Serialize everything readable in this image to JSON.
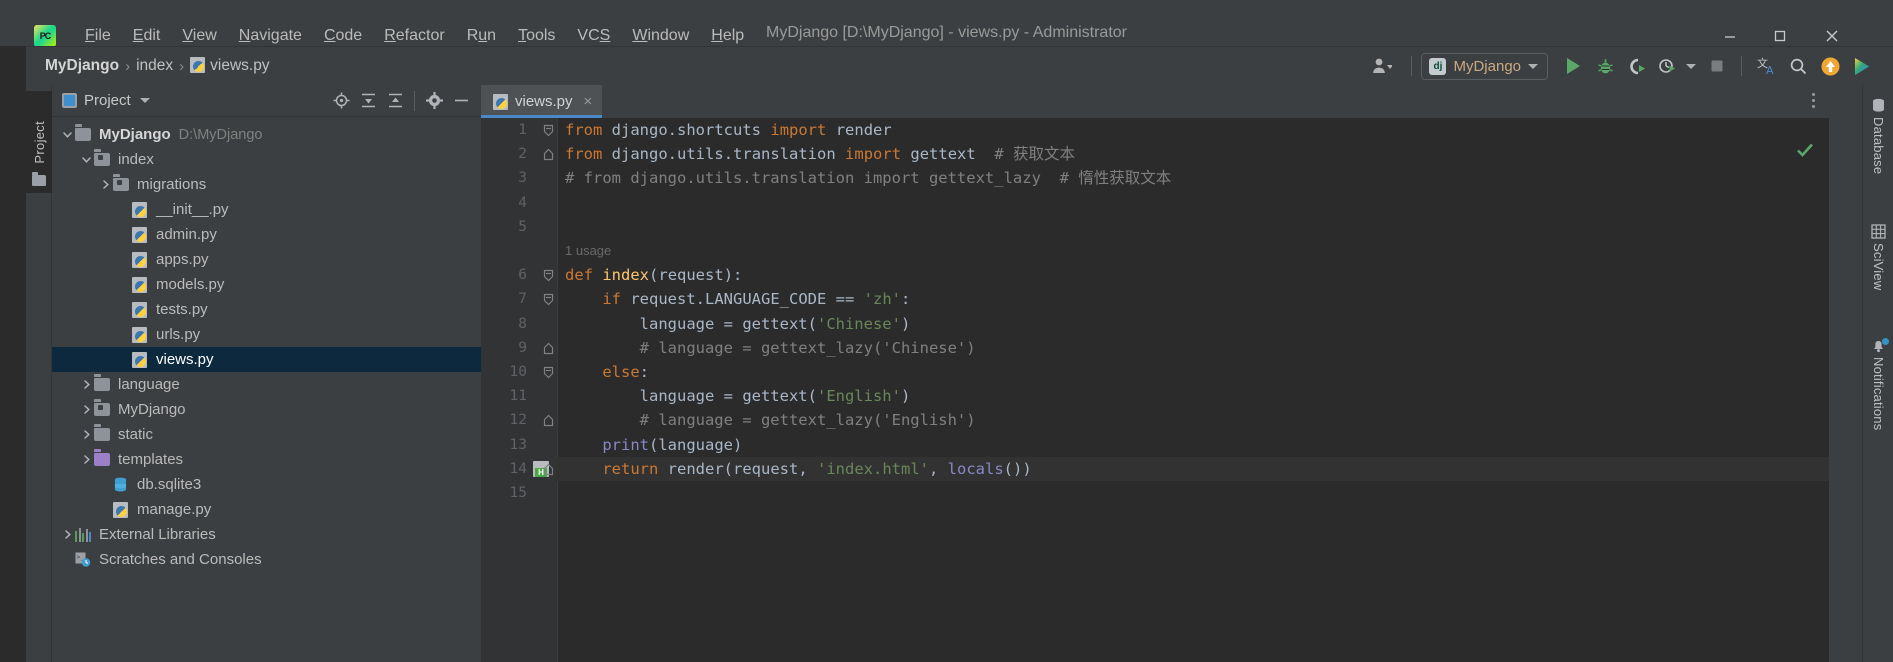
{
  "window": {
    "title": "MyDjango [D:\\MyDjango] - views.py - Administrator",
    "logo_text": "PC",
    "minimize_icon": "minimize-icon",
    "maximize_icon": "maximize-icon",
    "close_icon": "close-icon"
  },
  "menubar": [
    {
      "label": "File",
      "mnemonic": "F"
    },
    {
      "label": "Edit",
      "mnemonic": "E"
    },
    {
      "label": "View",
      "mnemonic": "V"
    },
    {
      "label": "Navigate",
      "mnemonic": "N"
    },
    {
      "label": "Code",
      "mnemonic": "C"
    },
    {
      "label": "Refactor",
      "mnemonic": "R"
    },
    {
      "label": "Run",
      "mnemonic": "u"
    },
    {
      "label": "Tools",
      "mnemonic": "T"
    },
    {
      "label": "VCS",
      "mnemonic": "S"
    },
    {
      "label": "Window",
      "mnemonic": "W"
    },
    {
      "label": "Help",
      "mnemonic": "H"
    }
  ],
  "breadcrumb": {
    "items": [
      "MyDjango",
      "index",
      "views.py"
    ],
    "separator": "›"
  },
  "toolbar": {
    "user_icon": "user-account-icon",
    "run_config": {
      "label": "MyDjango",
      "badge": "dj"
    },
    "run_icon": "run-icon",
    "debug_icon": "debug-bug-icon",
    "coverage_icon": "run-with-coverage-icon",
    "profile_icon": "profile-clock-icon",
    "stop_icon": "stop-icon",
    "translate_icon": "translate-icon",
    "search_icon": "search-icon",
    "update_icon": "update-project-icon",
    "datalore_icon": "datalore-icon"
  },
  "left_strip": {
    "project_tab": "Project"
  },
  "project_panel": {
    "title": "Project",
    "tools": [
      "locate-icon",
      "expand-all-icon",
      "collapse-all-icon",
      "settings-gear-icon",
      "hide-icon"
    ],
    "tree": [
      {
        "label": "MyDjango",
        "path": "D:\\MyDjango",
        "icon": "folder-icon",
        "depth": 0,
        "arrow": "down",
        "bold": true,
        "selected": false
      },
      {
        "label": "index",
        "path": "",
        "icon": "folder-source-icon",
        "depth": 1,
        "arrow": "down",
        "bold": false,
        "selected": false
      },
      {
        "label": "migrations",
        "path": "",
        "icon": "folder-source-icon",
        "depth": 2,
        "arrow": "right",
        "bold": false,
        "selected": false
      },
      {
        "label": "__init__.py",
        "path": "",
        "icon": "python-file-icon",
        "depth": 3,
        "arrow": "none",
        "bold": false,
        "selected": false
      },
      {
        "label": "admin.py",
        "path": "",
        "icon": "python-file-icon",
        "depth": 3,
        "arrow": "none",
        "bold": false,
        "selected": false
      },
      {
        "label": "apps.py",
        "path": "",
        "icon": "python-file-icon",
        "depth": 3,
        "arrow": "none",
        "bold": false,
        "selected": false
      },
      {
        "label": "models.py",
        "path": "",
        "icon": "python-file-icon",
        "depth": 3,
        "arrow": "none",
        "bold": false,
        "selected": false
      },
      {
        "label": "tests.py",
        "path": "",
        "icon": "python-file-icon",
        "depth": 3,
        "arrow": "none",
        "bold": false,
        "selected": false
      },
      {
        "label": "urls.py",
        "path": "",
        "icon": "python-file-icon",
        "depth": 3,
        "arrow": "none",
        "bold": false,
        "selected": false
      },
      {
        "label": "views.py",
        "path": "",
        "icon": "python-file-icon",
        "depth": 3,
        "arrow": "none",
        "bold": false,
        "selected": true
      },
      {
        "label": "language",
        "path": "",
        "icon": "folder-icon",
        "depth": 1,
        "arrow": "right",
        "bold": false,
        "selected": false
      },
      {
        "label": "MyDjango",
        "path": "",
        "icon": "folder-source-icon",
        "depth": 1,
        "arrow": "right",
        "bold": false,
        "selected": false
      },
      {
        "label": "static",
        "path": "",
        "icon": "folder-icon",
        "depth": 1,
        "arrow": "right",
        "bold": false,
        "selected": false
      },
      {
        "label": "templates",
        "path": "",
        "icon": "folder-templates-icon",
        "depth": 1,
        "arrow": "right",
        "bold": false,
        "selected": false
      },
      {
        "label": "db.sqlite3",
        "path": "",
        "icon": "database-file-icon",
        "depth": 2,
        "arrow": "none",
        "bold": false,
        "selected": false
      },
      {
        "label": "manage.py",
        "path": "",
        "icon": "python-file-icon",
        "depth": 2,
        "arrow": "none",
        "bold": false,
        "selected": false
      },
      {
        "label": "External Libraries",
        "path": "",
        "icon": "external-libraries-icon",
        "depth": 0,
        "arrow": "right",
        "bold": false,
        "selected": false
      },
      {
        "label": "Scratches and Consoles",
        "path": "",
        "icon": "scratches-icon",
        "depth": 0,
        "arrow": "none",
        "bold": false,
        "selected": false
      }
    ]
  },
  "editor": {
    "tab": {
      "label": "views.py",
      "icon": "python-file-icon",
      "close": "×"
    },
    "kebab_icon": "more-options-icon",
    "inspection_status": "ok-checkmark",
    "usage_hint": "1 usage",
    "lines": [
      {
        "n": "1",
        "fold": "start",
        "gutter": ""
      },
      {
        "n": "2",
        "fold": "end",
        "gutter": ""
      },
      {
        "n": "3",
        "fold": "none",
        "gutter": ""
      },
      {
        "n": "4",
        "fold": "none",
        "gutter": ""
      },
      {
        "n": "5",
        "fold": "none",
        "gutter": ""
      },
      {
        "n": "6",
        "fold": "start",
        "gutter": ""
      },
      {
        "n": "7",
        "fold": "start",
        "gutter": ""
      },
      {
        "n": "8",
        "fold": "none",
        "gutter": ""
      },
      {
        "n": "9",
        "fold": "end",
        "gutter": ""
      },
      {
        "n": "10",
        "fold": "start",
        "gutter": ""
      },
      {
        "n": "11",
        "fold": "none",
        "gutter": ""
      },
      {
        "n": "12",
        "fold": "end",
        "gutter": ""
      },
      {
        "n": "13",
        "fold": "none",
        "gutter": ""
      },
      {
        "n": "14",
        "fold": "end",
        "gutter": "html-icon"
      },
      {
        "n": "15",
        "fold": "none",
        "gutter": ""
      }
    ],
    "code_plain": [
      "from django.shortcuts import render",
      "from django.utils.translation import gettext  # 获取文本",
      "# from django.utils.translation import gettext_lazy  # 惰性获取文本",
      "",
      "",
      "def index(request):",
      "    if request.LANGUAGE_CODE == 'zh':",
      "        language = gettext('Chinese')",
      "        # language = gettext_lazy('Chinese')",
      "    else:",
      "        language = gettext('English')",
      "        # language = gettext_lazy('English')",
      "    print(language)",
      "    return render(request, 'index.html', locals())",
      ""
    ]
  },
  "right_strip": {
    "tabs": [
      {
        "label": "Database",
        "icon": "database-icon",
        "badge": false
      },
      {
        "label": "SciView",
        "icon": "sciview-grid-icon",
        "badge": false
      },
      {
        "label": "Notifications",
        "icon": "notifications-bell-icon",
        "badge": true
      }
    ]
  },
  "colors": {
    "accent_blue": "#4a88c7",
    "selection_blue": "#0d293e",
    "keyword_orange": "#cc7832",
    "string_green": "#6a8759",
    "function_yellow": "#ffc66d",
    "comment_gray": "#808080",
    "builtin_purple": "#8888c6",
    "default_text": "#a9b7c6",
    "editor_bg": "#2b2b2b",
    "panel_bg": "#3c3f41",
    "run_green": "#59a869",
    "update_orange": "#f0a732"
  }
}
